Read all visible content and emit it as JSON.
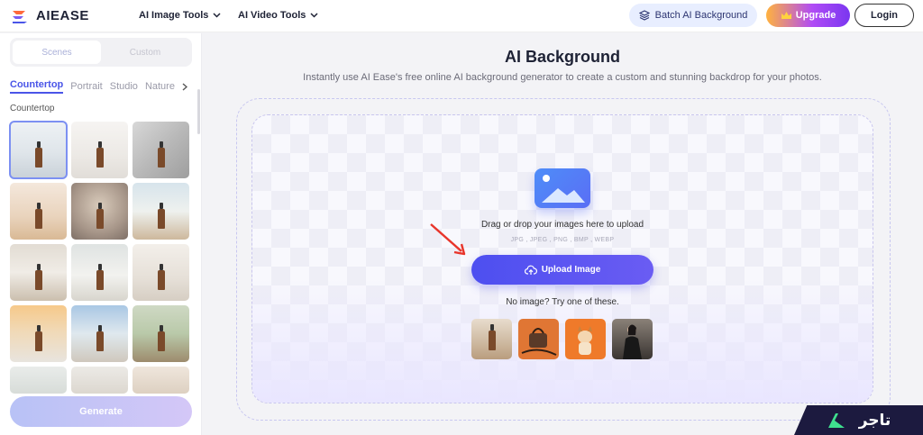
{
  "header": {
    "logo_text": "AIEASE",
    "nav": [
      {
        "label": "AI Image Tools"
      },
      {
        "label": "AI Video Tools"
      }
    ],
    "batch_label": "Batch AI Background",
    "upgrade_label": "Upgrade",
    "login_label": "Login"
  },
  "sidebar": {
    "segments": [
      "Scenes",
      "Custom"
    ],
    "categories": [
      "Countertop",
      "Portrait",
      "Studio",
      "Nature"
    ],
    "section_label": "Countertop",
    "generate_label": "Generate"
  },
  "main": {
    "title": "AI Background",
    "subtitle": "Instantly use AI Ease's free online AI background generator to create a custom and stunning backdrop for your photos.",
    "drag_text": "Drag or drop your images here to upload",
    "formats": "JPG , JPEG , PNG , BMP , WEBP",
    "upload_label": "Upload Image",
    "no_image_text": "No image? Try one of these."
  },
  "watermark": "تاجر",
  "colors": {
    "accent": "#4a55e8",
    "upload_button": "#5552f1",
    "login_border": "#333333"
  }
}
